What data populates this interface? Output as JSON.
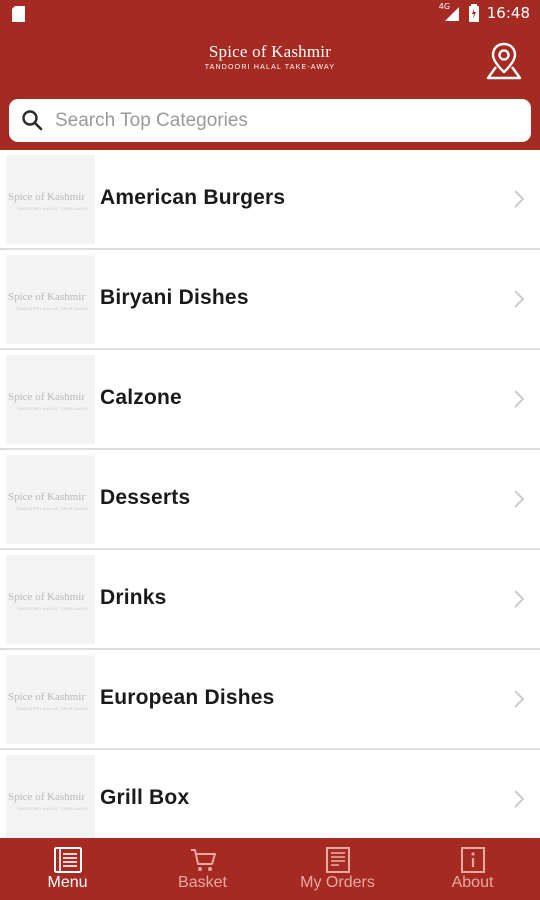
{
  "status_bar": {
    "network": "4G",
    "time": "16:48",
    "icons": [
      "sim-card-icon",
      "signal-icon",
      "battery-icon"
    ]
  },
  "header": {
    "brand_name": "Spice of Kashmir",
    "brand_tagline": "TANDOORI HALAL TAKE-AWAY",
    "location_icon": "map-pin-icon"
  },
  "search": {
    "placeholder": "Search Top Categories",
    "value": ""
  },
  "categories": [
    {
      "label": "American Burgers"
    },
    {
      "label": "Biryani Dishes"
    },
    {
      "label": "Calzone"
    },
    {
      "label": "Desserts"
    },
    {
      "label": "Drinks"
    },
    {
      "label": "European Dishes"
    },
    {
      "label": "Grill Box"
    }
  ],
  "thumbnail": {
    "name": "Spice of Kashmir",
    "tagline": "TANDOORI HALAL TAKE-AWAY"
  },
  "tabs": [
    {
      "label": "Menu",
      "icon": "menu-book-icon",
      "active": true
    },
    {
      "label": "Basket",
      "icon": "cart-icon",
      "active": false
    },
    {
      "label": "My Orders",
      "icon": "receipt-icon",
      "active": false
    },
    {
      "label": "About",
      "icon": "info-icon",
      "active": false
    }
  ],
  "colors": {
    "brand": "#a52a22",
    "tab_inactive": "#e9a7a2"
  }
}
